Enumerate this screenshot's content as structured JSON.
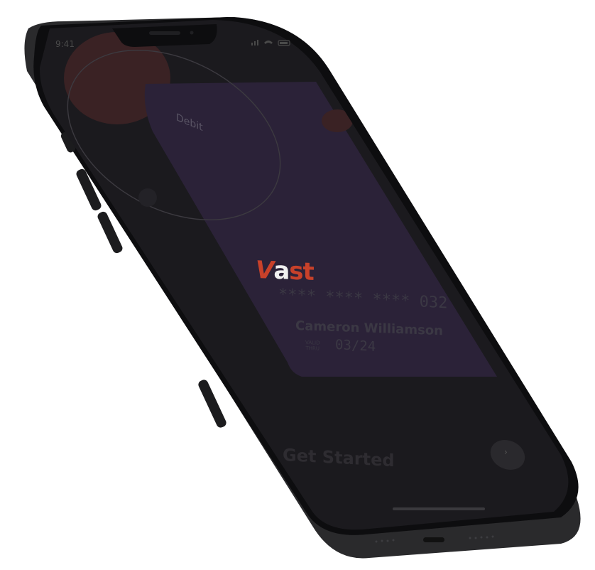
{
  "status_bar": {
    "time": "9:41"
  },
  "card": {
    "type": "Debit",
    "brand_parts": {
      "v": "V",
      "a": "a",
      "st": "st"
    },
    "number": "**** **** **** 032",
    "holder": "Cameron Williamson",
    "valid_label_line1": "VALID",
    "valid_label_line2": "THRU",
    "valid_thru": "03/24"
  },
  "cta": {
    "label": "Get Started",
    "next_icon": "chevron-right-icon",
    "next_glyph": "›"
  },
  "colors": {
    "accent": "#c8412a",
    "card_bg": "#2b2238",
    "screen_bg": "#1b1a1e",
    "frame": "#2d2d2f"
  }
}
